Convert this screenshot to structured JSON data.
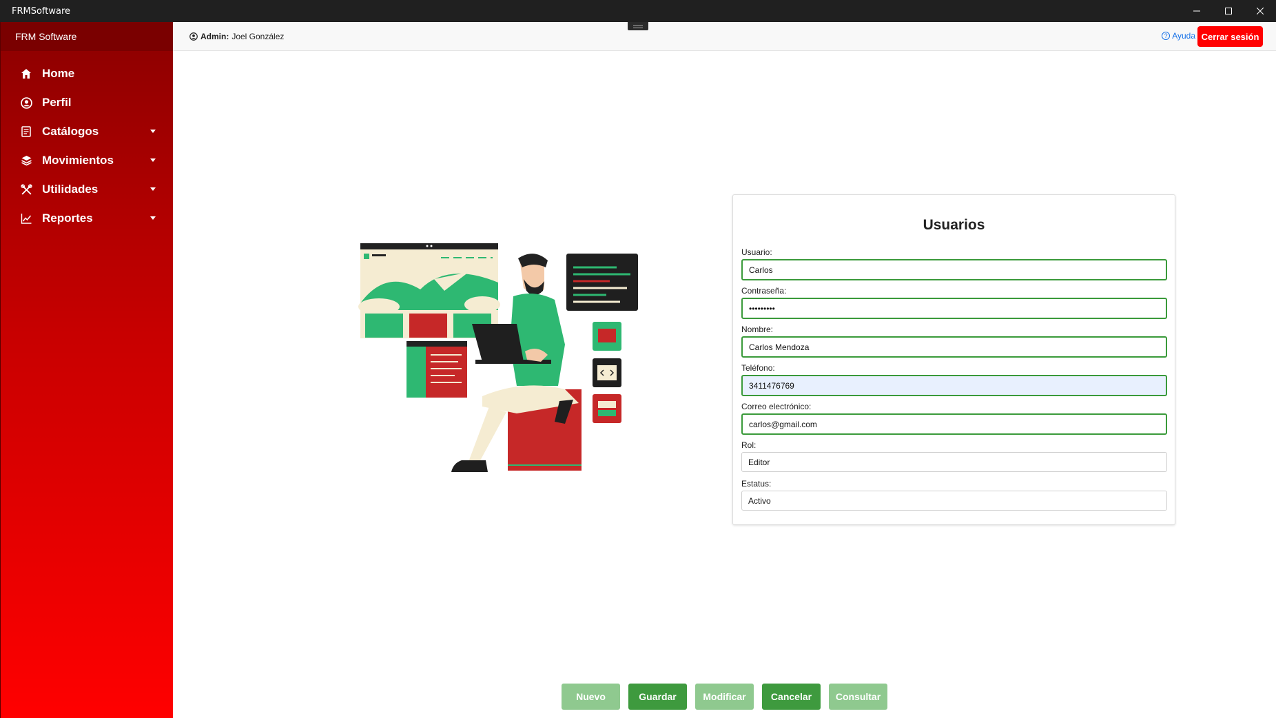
{
  "window": {
    "title": "FRMSoftware"
  },
  "sidebar": {
    "brand": "FRM Software",
    "items": [
      {
        "label": "Home",
        "icon": "home-icon",
        "has_submenu": false
      },
      {
        "label": "Perfil",
        "icon": "user-circle-icon",
        "has_submenu": false
      },
      {
        "label": "Catálogos",
        "icon": "catalog-icon",
        "has_submenu": true
      },
      {
        "label": "Movimientos",
        "icon": "layers-icon",
        "has_submenu": true
      },
      {
        "label": "Utilidades",
        "icon": "tools-icon",
        "has_submenu": true
      },
      {
        "label": "Reportes",
        "icon": "chart-icon",
        "has_submenu": true
      }
    ]
  },
  "header": {
    "role": "Admin:",
    "user": "Joel González",
    "help": "Ayuda",
    "logout": "Cerrar sesión"
  },
  "form": {
    "title": "Usuarios",
    "fields": [
      {
        "label": "Usuario:",
        "value": "Carlos"
      },
      {
        "label": "Contraseña:",
        "value": "•••••••••"
      },
      {
        "label": "Nombre:",
        "value": "Carlos Mendoza"
      },
      {
        "label": "Teléfono:",
        "value": "3411476769"
      },
      {
        "label": "Correo electrónico:",
        "value": "carlos@gmail.com"
      },
      {
        "label": "Rol:",
        "value": "Editor"
      },
      {
        "label": "Estatus:",
        "value": "Activo"
      }
    ]
  },
  "actions": {
    "nuevo": "Nuevo",
    "guardar": "Guardar",
    "modificar": "Modificar",
    "cancelar": "Cancelar",
    "consultar": "Consultar"
  },
  "colors": {
    "sidebar_top": "#8b0000",
    "sidebar_bottom": "#ff0000",
    "logout": "#ff0000",
    "field_border": "#3a9a3a",
    "button_active": "#3e9a3e",
    "button_disabled": "#8fc98f"
  }
}
